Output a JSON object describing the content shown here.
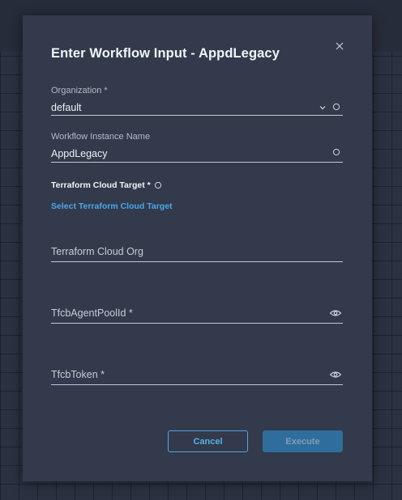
{
  "dialog": {
    "title": "Enter Workflow Input - AppdLegacy"
  },
  "fields": {
    "organization": {
      "label": "Organization *",
      "value": "default"
    },
    "workflow_instance_name": {
      "label": "Workflow Instance Name",
      "value": "AppdLegacy"
    },
    "terraform_cloud_target": {
      "label": "Terraform Cloud Target *",
      "link": "Select Terraform Cloud Target"
    },
    "terraform_cloud_org": {
      "placeholder": "Terraform Cloud Org"
    },
    "tfcb_agent_pool_id": {
      "placeholder": "TfcbAgentPoolId *"
    },
    "tfcb_token": {
      "placeholder": "TfcbToken *"
    }
  },
  "buttons": {
    "cancel": "Cancel",
    "execute": "Execute"
  },
  "colors": {
    "accent": "#4ba8ea",
    "modal_bg": "#323a4c",
    "primary_button": "#2f6e9c"
  }
}
